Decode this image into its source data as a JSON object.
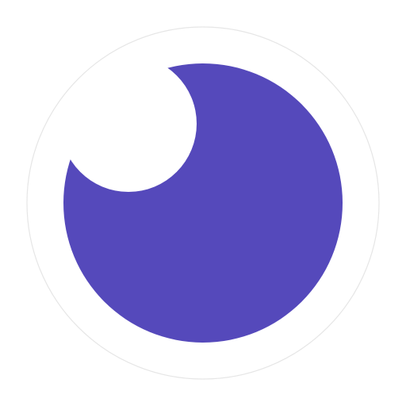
{
  "icon": {
    "name": "crescent-moon-app-icon",
    "colors": {
      "background": "#ffffff",
      "badge": "#ffffff",
      "badge_border": "#e6e6e6",
      "moon": "#5549bb"
    }
  }
}
